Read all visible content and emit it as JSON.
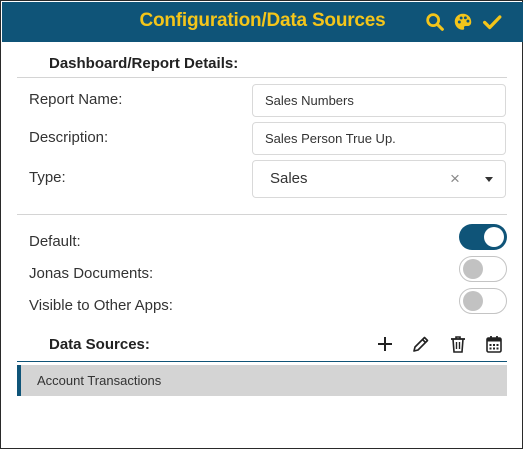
{
  "header": {
    "title": "Configuration/Data Sources",
    "icons": [
      "search-icon",
      "palette-icon",
      "check-icon"
    ],
    "title_color": "#f4c51a",
    "background": "#0f5478"
  },
  "details": {
    "section_title": "Dashboard/Report Details:",
    "report_name": {
      "label": "Report Name:",
      "value": "Sales Numbers"
    },
    "description": {
      "label": "Description:",
      "value": "Sales Person True Up."
    },
    "type": {
      "label": "Type:",
      "value": "Sales"
    }
  },
  "toggles": {
    "default": {
      "label": "Default:",
      "on": true
    },
    "jonas_documents": {
      "label": "Jonas Documents:",
      "on": false
    },
    "visible_other_apps": {
      "label": "Visible to Other Apps:",
      "on": false
    }
  },
  "data_sources": {
    "section_title": "Data Sources:",
    "icons": [
      "plus-icon",
      "pencil-icon",
      "trash-icon",
      "calendar-icon"
    ],
    "items": [
      {
        "label": "Account Transactions"
      }
    ]
  }
}
